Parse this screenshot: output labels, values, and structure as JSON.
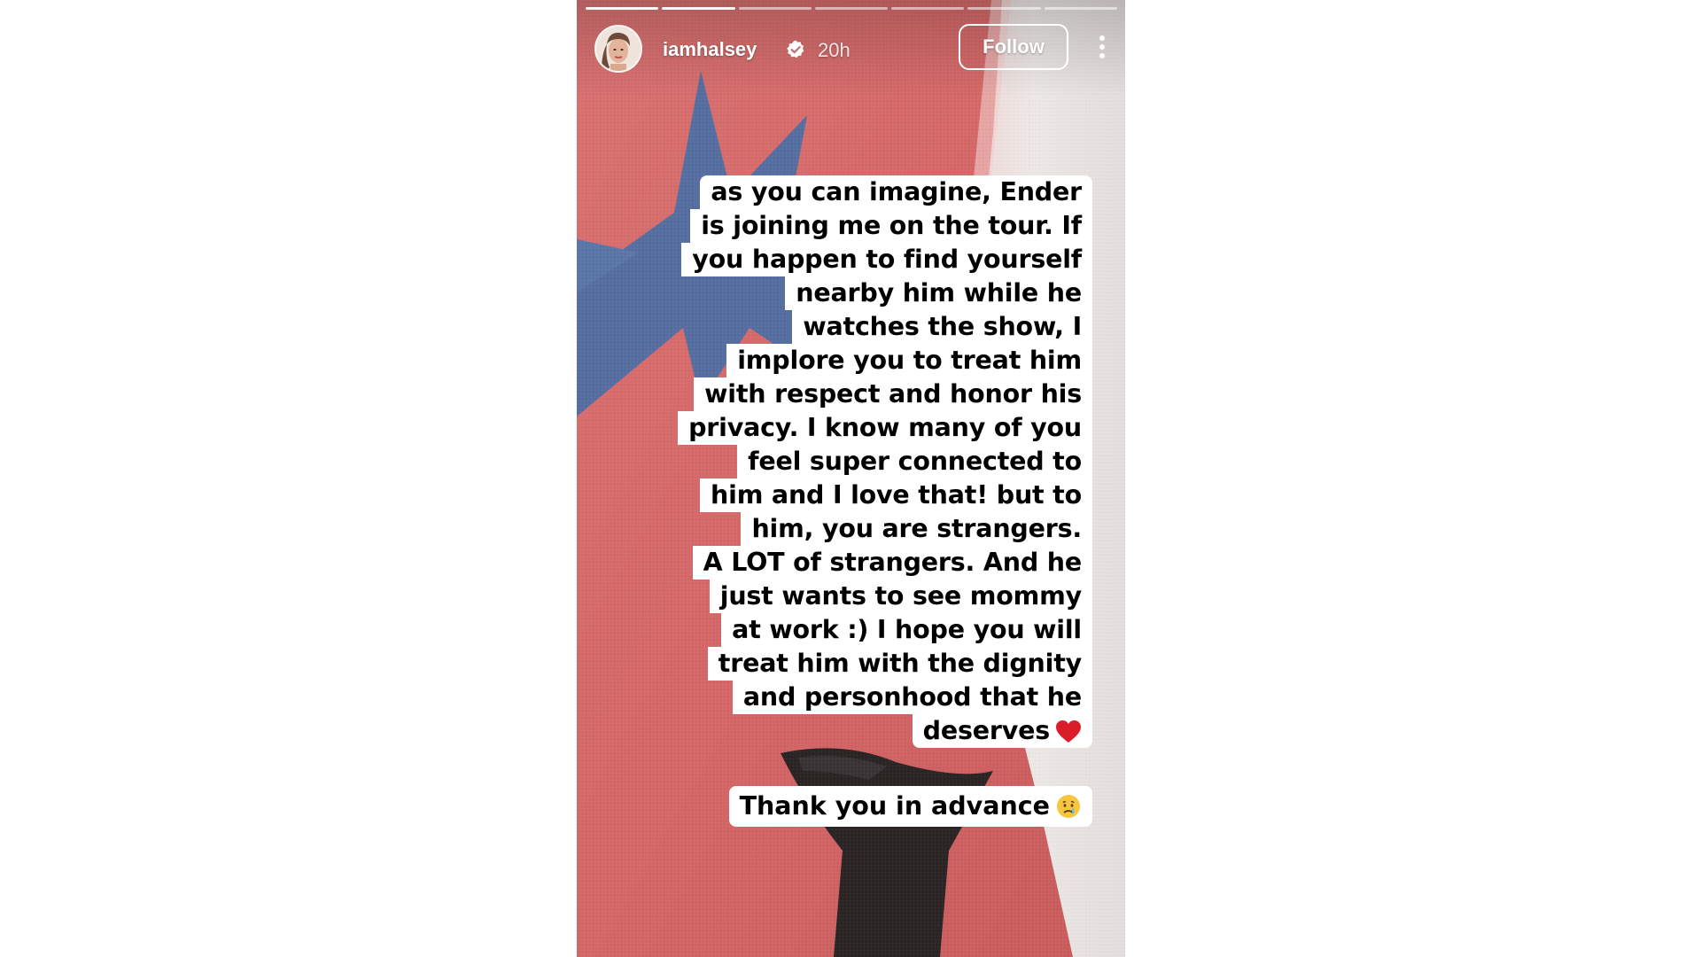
{
  "story": {
    "progress_segments_total": 7,
    "progress_segments_done": 2,
    "header": {
      "username": "iamhalsey",
      "verified_icon": "verified-badge-icon",
      "time_ago": "20h",
      "follow_label": "Follow",
      "more_icon": "more-vertical-icon"
    },
    "caption_lines": [
      "as you can imagine, Ender",
      "is joining me on the tour. If",
      "you happen to find yourself",
      "nearby him while he",
      "watches the show, I",
      "implore you to treat him",
      "with respect and honor his",
      "privacy. I know many of you",
      "feel super connected to",
      "him and I love that! but to",
      "him, you are strangers.",
      "A LOT of strangers. And he",
      "just wants to see mommy",
      "at work :) I hope you will",
      "treat him with the dignity",
      "and personhood that he",
      "deserves"
    ],
    "caption_end_emoji": "red-heart-icon",
    "thanks_text": "Thank you in advance",
    "thanks_emoji": "crying-face-icon",
    "colors": {
      "fabric_red": "#d46a6a",
      "star_blue": "#4f6fa3",
      "stripe_white": "#ece8e6",
      "dark_shape": "#2b2526",
      "heart_red": "#d91e2a"
    }
  }
}
